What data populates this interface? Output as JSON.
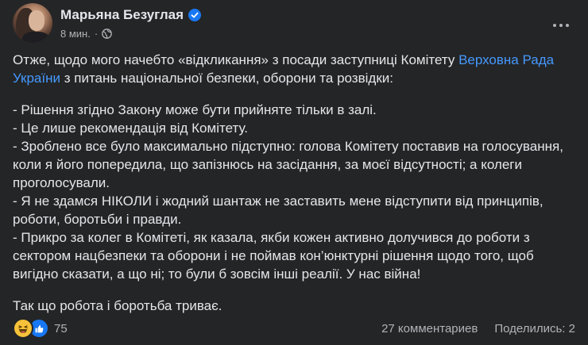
{
  "post": {
    "author": "Марьяна Безуглая",
    "time": "8 мин.",
    "separator": "·",
    "paragraph1_part1": "Отже, щодо мого начебто «відкликання» з посади заступниці Комітету ",
    "paragraph1_link": "Верховна Рада України",
    "paragraph1_part2": " з питань національної безпеки, оборони та розвідки:",
    "bullets": [
      "- Рішення згідно Закону може бути прийняте тільки в залі.",
      "- Це лише рекомендація від Комітету.",
      "- Зроблено все було максимально підступно: голова Комітету поставив на голосування, коли я його попередила, що запізнюсь на засідання, за моєї відсутності; а колеги проголосували.",
      "- Я не здамся НІКОЛИ і жодний шантаж не заставить мене відступити від принципів, роботи, боротьби і правди.",
      "- Прикро за колег в Комітеті, як казала, якби кожен активно долучився до роботи з сектором нацбезпеки та оборони і не поймав кон’юнктурні рішення щодо того, щоб вигідно сказати, а що ні; то були б зовсім інші реалії. У нас війна!"
    ],
    "closing": "Так що робота і боротьба триває."
  },
  "footer": {
    "reaction_count": "75",
    "comments": "27 комментариев",
    "shares": "Поделились: 2"
  },
  "icons": {
    "verified": "verified-badge-icon",
    "privacy": "globe-icon",
    "more": "more-options-icon",
    "reactions": [
      "haha-reaction-icon",
      "like-reaction-icon"
    ]
  },
  "colors": {
    "background": "#242526",
    "text": "#e4e6eb",
    "secondary_text": "#b0b3b8",
    "link": "#4599ff",
    "verified": "#1877f2"
  }
}
